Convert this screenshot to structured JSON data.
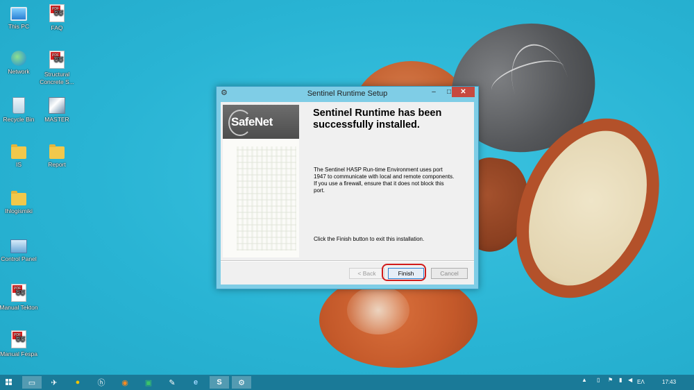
{
  "desktop": {
    "icons": [
      {
        "label": "This PC",
        "icon": "computer-icon"
      },
      {
        "label": "FAQ",
        "icon": "pdf-icon"
      },
      {
        "label": "Network",
        "icon": "network-icon"
      },
      {
        "label": "Structural Concrete S...",
        "icon": "pdf-icon"
      },
      {
        "label": "Recycle Bin",
        "icon": "recycle-bin-icon"
      },
      {
        "label": "MASTER",
        "icon": "program-icon"
      },
      {
        "label": "IS",
        "icon": "folder-icon"
      },
      {
        "label": "Report",
        "icon": "folder-icon"
      },
      {
        "label": "Ihlogismiki",
        "icon": "folder-icon"
      },
      {
        "label": "Control Panel",
        "icon": "control-panel-icon"
      },
      {
        "label": "Manual Tekton",
        "icon": "pdf-icon"
      },
      {
        "label": "Manual Fespa",
        "icon": "pdf-icon"
      }
    ]
  },
  "dialog": {
    "title": "Sentinel Runtime Setup",
    "controls": {
      "minimize": "–",
      "maximize": "□",
      "close": "✕"
    },
    "logo_text": "SafeNet",
    "heading": "Sentinel Runtime has been successfully installed.",
    "info": "The Sentinel HASP Run-time Environment uses port 1947 to communicate with local and remote components. If you use a firewall, ensure that it does not block this port.",
    "finish_instruction": "Click the Finish button to exit this installation.",
    "buttons": {
      "back": "< Back",
      "finish": "Finish",
      "cancel": "Cancel"
    },
    "highlight_color": "#d11b1b"
  },
  "taskbar": {
    "items": [
      {
        "name": "file-explorer-icon",
        "glyph": "▭"
      },
      {
        "name": "pinned-app-icon",
        "glyph": "✈"
      },
      {
        "name": "norton-icon",
        "glyph": "●"
      },
      {
        "name": "hp-icon",
        "glyph": "ⓗ"
      },
      {
        "name": "firefox-icon",
        "glyph": "◉"
      },
      {
        "name": "excel-icon",
        "glyph": "▣"
      },
      {
        "name": "paint-icon",
        "glyph": "✎"
      },
      {
        "name": "internet-explorer-icon",
        "glyph": "e"
      },
      {
        "name": "skype-icon",
        "glyph": "S"
      },
      {
        "name": "setup-app-icon",
        "glyph": "⚙"
      }
    ],
    "language": "ΕΛ",
    "time": "17:43"
  },
  "colors": {
    "desktop_bg": "#2eb7d6",
    "taskbar_bg": "#1a7a98",
    "window_frame": "#7fcde6",
    "close_button": "#c7493f"
  }
}
